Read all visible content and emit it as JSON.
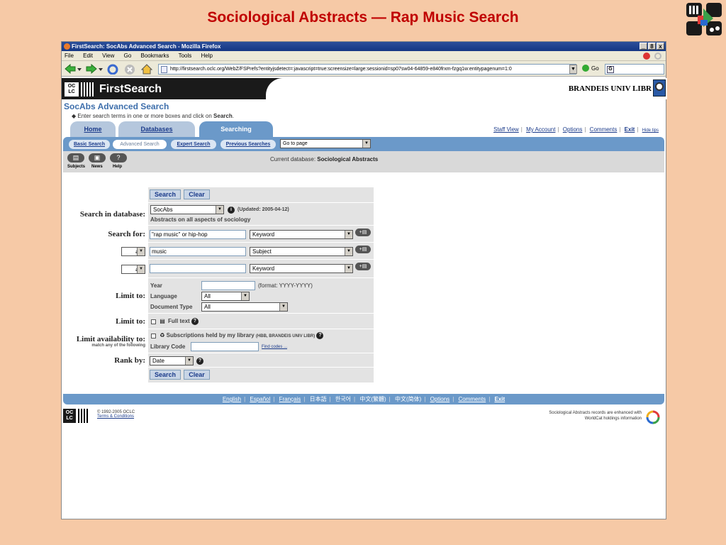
{
  "slide_title": "Sociological Abstracts — Rap Music Search",
  "window": {
    "title": "FirstSearch: SocAbs Advanced Search - Mozilla Firefox",
    "buttons": [
      "_",
      "8",
      "x"
    ]
  },
  "menu": [
    "File",
    "Edit",
    "View",
    "Go",
    "Bookmarks",
    "Tools",
    "Help"
  ],
  "nav": {
    "url": "http://firstsearch.oclc.org/WebZ/FSPrefs?entityjsdetect=:javascript=true:screensize=large:sessionid=sp07sw04-64859-e840frxm-fzgq1w:entitypagenum=1:0",
    "go_label": "Go",
    "search_glyph": "G"
  },
  "header": {
    "logo_text": "OC LC",
    "brand": "FirstSearch",
    "library": "BRANDEIS UNIV LIBR"
  },
  "page": {
    "title": "SocAbs Advanced Search",
    "instruction_prefix": "◆ Enter search terms in one or more boxes and click on ",
    "instruction_bold": "Search",
    "instruction_suffix": "."
  },
  "tabs": [
    "Home",
    "Databases",
    "Searching"
  ],
  "top_links": [
    "Staff View",
    "My Account",
    "Options",
    "Comments",
    "Exit",
    "Hide tips"
  ],
  "subnav": {
    "items": [
      "Basic Search",
      "Advanced Search",
      "Expert Search",
      "Previous Searches"
    ],
    "goto": "Go to page"
  },
  "iconbar": {
    "labels": [
      "Subjects",
      "News",
      "Help"
    ],
    "current_db_prefix": "Current database: ",
    "current_db": "Sociological Abstracts"
  },
  "form": {
    "search_btn": "Search",
    "clear_btn": "Clear",
    "db_label": "Search in database:",
    "db_value": "SocAbs",
    "db_updated": "(Updated: 2005-04-12)",
    "db_desc": "Abstracts on all aspects of sociology",
    "search_for_label": "Search for:",
    "rows": [
      {
        "bool": "",
        "term": "\"rap music\" or hip-hop",
        "index": "Keyword"
      },
      {
        "bool": "and",
        "term": "music",
        "index": "Subject"
      },
      {
        "bool": "and",
        "term": "",
        "index": "Keyword"
      }
    ],
    "limit_label": "Limit to:",
    "year_label": "Year",
    "year_format": "(format: YYYY-YYYY)",
    "language_label": "Language",
    "language_value": "All",
    "doctype_label": "Document Type",
    "doctype_value": "All",
    "limit2_label": "Limit to:",
    "fulltext": "Full text",
    "avail_label": "Limit availability to:",
    "avail_sub": "match any of the following",
    "subs_label": "Subscriptions held by my library",
    "subs_detail": "(HBB, BRANDEIS UNIV LIBR)",
    "libcode_label": "Library Code",
    "find_codes": "Find codes ...",
    "rank_label": "Rank by:",
    "rank_value": "Date"
  },
  "bottom_links": [
    "English",
    "Español",
    "Français",
    "日本語",
    "한국어",
    "中文(繁體)",
    "中文(简体)",
    "Options",
    "Comments",
    "Exit"
  ],
  "footer": {
    "copyright": "© 1992-2005 OCLC",
    "terms": "Terms & Conditions",
    "note_line1": "Sociological Abstracts records are enhanced with",
    "note_line2": "WorldCat holdings information"
  }
}
